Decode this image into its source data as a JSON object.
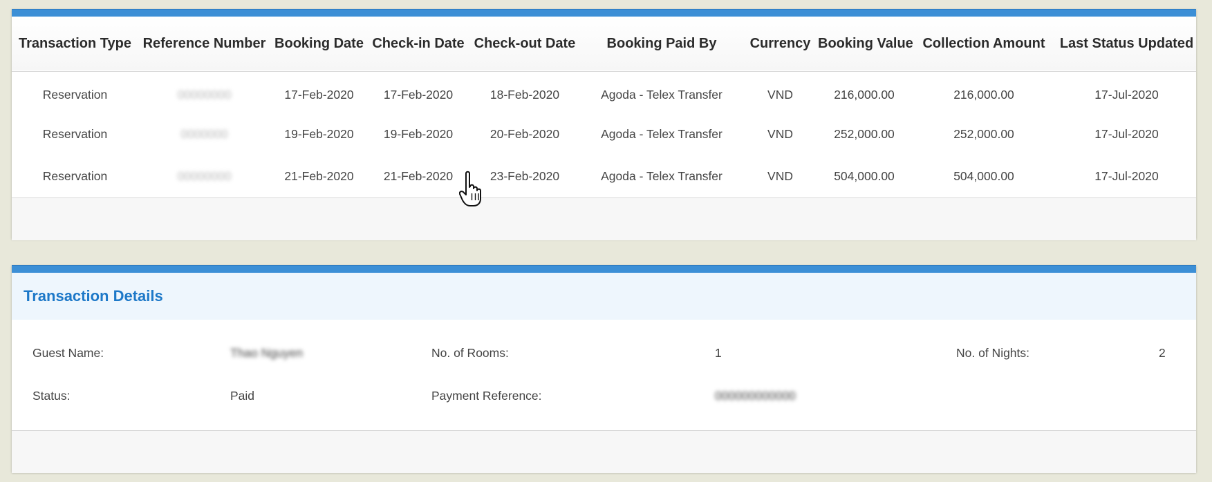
{
  "transactions": {
    "columns": [
      "Transaction Type",
      "Reference Number",
      "Booking Date",
      "Check-in Date",
      "Check-out Date",
      "Booking Paid By",
      "Currency",
      "Booking Value",
      "Collection Amount",
      "Last Status Updated"
    ],
    "rows": [
      [
        "Reservation",
        "00000000",
        "17-Feb-2020",
        "17-Feb-2020",
        "18-Feb-2020",
        "Agoda - Telex Transfer",
        "VND",
        "216,000.00",
        "216,000.00",
        "17-Jul-2020"
      ],
      [
        "Reservation",
        "0000000",
        "19-Feb-2020",
        "19-Feb-2020",
        "20-Feb-2020",
        "Agoda - Telex Transfer",
        "VND",
        "252,000.00",
        "252,000.00",
        "17-Jul-2020"
      ],
      [
        "Reservation",
        "00000000",
        "21-Feb-2020",
        "21-Feb-2020",
        "23-Feb-2020",
        "Agoda - Telex Transfer",
        "VND",
        "504,000.00",
        "504,000.00",
        "17-Jul-2020"
      ]
    ]
  },
  "details": {
    "title": "Transaction Details",
    "guest_name_label": "Guest Name:",
    "guest_name_value": "Thao Nguyen",
    "rooms_label": "No. of Rooms:",
    "rooms_value": "1",
    "nights_label": "No. of Nights:",
    "nights_value": "2",
    "status_label": "Status:",
    "status_value": "Paid",
    "payment_ref_label": "Payment Reference:",
    "payment_ref_value": "000000000000"
  },
  "colors": {
    "accent_bar": "#3c8fd6",
    "title_blue": "#1d78c8",
    "page_background": "#e8e8da"
  },
  "cursor": {
    "icon": "hand-pointer-icon"
  }
}
